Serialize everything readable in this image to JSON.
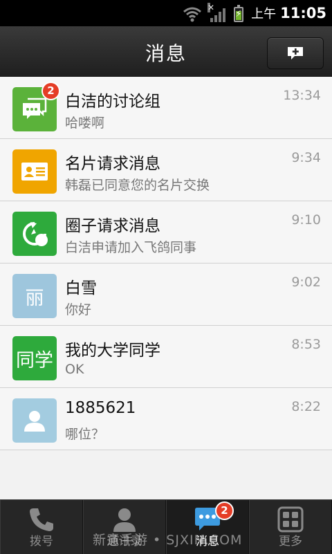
{
  "status_bar": {
    "ampm": "上午",
    "time": "11:05"
  },
  "header": {
    "title": "消息",
    "compose_icon": "compose-message-icon"
  },
  "conversations": [
    {
      "name": "白洁的讨论组",
      "preview": "哈喽啊",
      "time": "13:34",
      "badge": "2",
      "avatar_icon": "group-chat-icon",
      "avatar_color": "#5bb23a"
    },
    {
      "name": "名片请求消息",
      "preview": "韩磊已同意您的名片交换",
      "time": "9:34",
      "avatar_icon": "business-card-icon",
      "avatar_color": "#f0a500"
    },
    {
      "name": "圈子请求消息",
      "preview": "白洁申请加入飞鸽同事",
      "time": "9:10",
      "avatar_icon": "circle-request-icon",
      "avatar_color": "#2eaa3c"
    },
    {
      "name": "白雪",
      "preview": "你好",
      "time": "9:02",
      "avatar_text": "丽",
      "avatar_color": "#9ec6dd"
    },
    {
      "name": "我的大学同学",
      "preview": "OK",
      "time": "8:53",
      "avatar_text": "同学",
      "avatar_color": "#2eaa3c"
    },
    {
      "name": "1885621",
      "preview": "哪位？",
      "time": "8:22",
      "avatar_icon": "default-person-icon",
      "avatar_color": "#a3cce0"
    }
  ],
  "tabs": [
    {
      "label": "拨号",
      "icon": "phone-icon"
    },
    {
      "label": "通讯录",
      "icon": "contacts-icon"
    },
    {
      "label": "消息",
      "icon": "messages-icon",
      "badge": "2",
      "active": true
    },
    {
      "label": "更多",
      "icon": "more-grid-icon"
    }
  ],
  "watermark": "新意手游 • SJXIN.COM"
}
